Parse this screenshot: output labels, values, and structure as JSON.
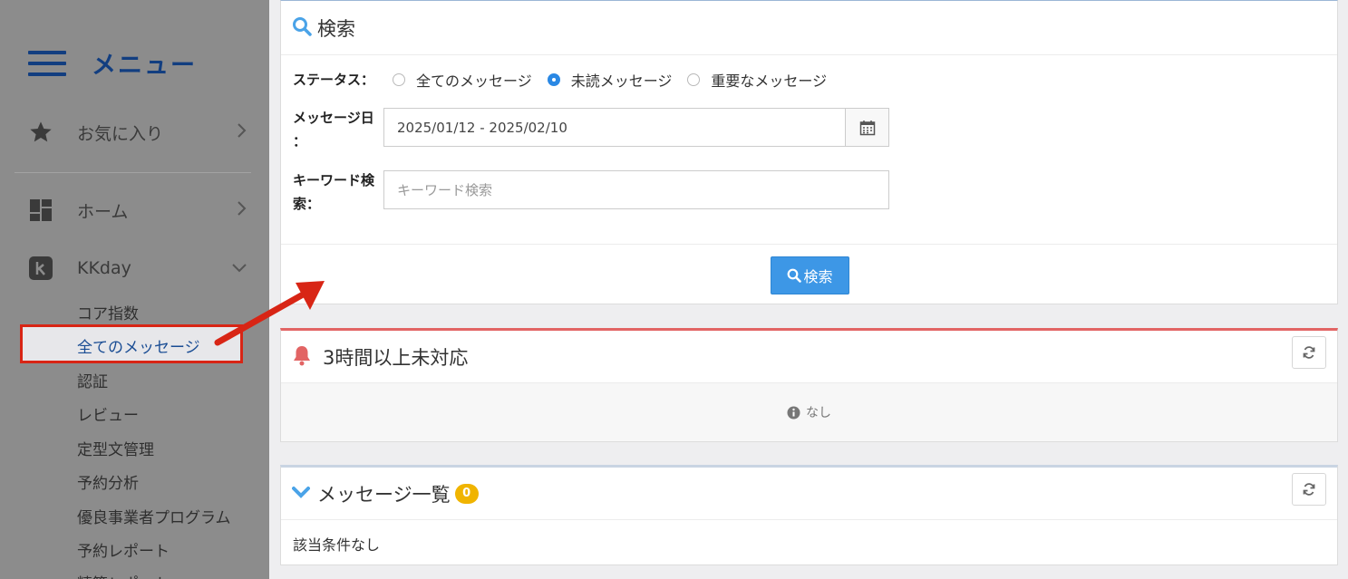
{
  "sidebar": {
    "title": "メニュー",
    "items": [
      {
        "label": "お気に入り",
        "icon": "star-icon"
      },
      {
        "label": "ホーム",
        "icon": "dashboard-icon"
      },
      {
        "label": "KKday",
        "icon": "kkday-logo-icon"
      }
    ],
    "sub_items": [
      "コア指数",
      "全てのメッセージ",
      "認証",
      "レビュー",
      "定型文管理",
      "予約分析",
      "優良事業者プログラム",
      "予約レポート",
      "精算レポート"
    ]
  },
  "search": {
    "title": "検索",
    "status_label": "ステータス：",
    "status_options": [
      "全てのメッセージ",
      "未読メッセージ",
      "重要なメッセージ"
    ],
    "status_selected": "未読メッセージ",
    "date_label_line1": "メッセージ日",
    "date_label_line2": "：",
    "date_value": "2025/01/12 - 2025/02/10",
    "keyword_label_line1": "キーワード検",
    "keyword_label_line2": "索：",
    "keyword_placeholder": "キーワード検索",
    "button_label": "検索"
  },
  "alert": {
    "title": "3時間以上未対応",
    "empty_text": "なし"
  },
  "messages": {
    "title": "メッセージ一覧",
    "count": "0",
    "empty_text": "該当条件なし"
  },
  "colors": {
    "accent": "#3d97e6",
    "alert": "#e26464",
    "badge": "#f0b400",
    "highlight_box": "#d82515"
  }
}
